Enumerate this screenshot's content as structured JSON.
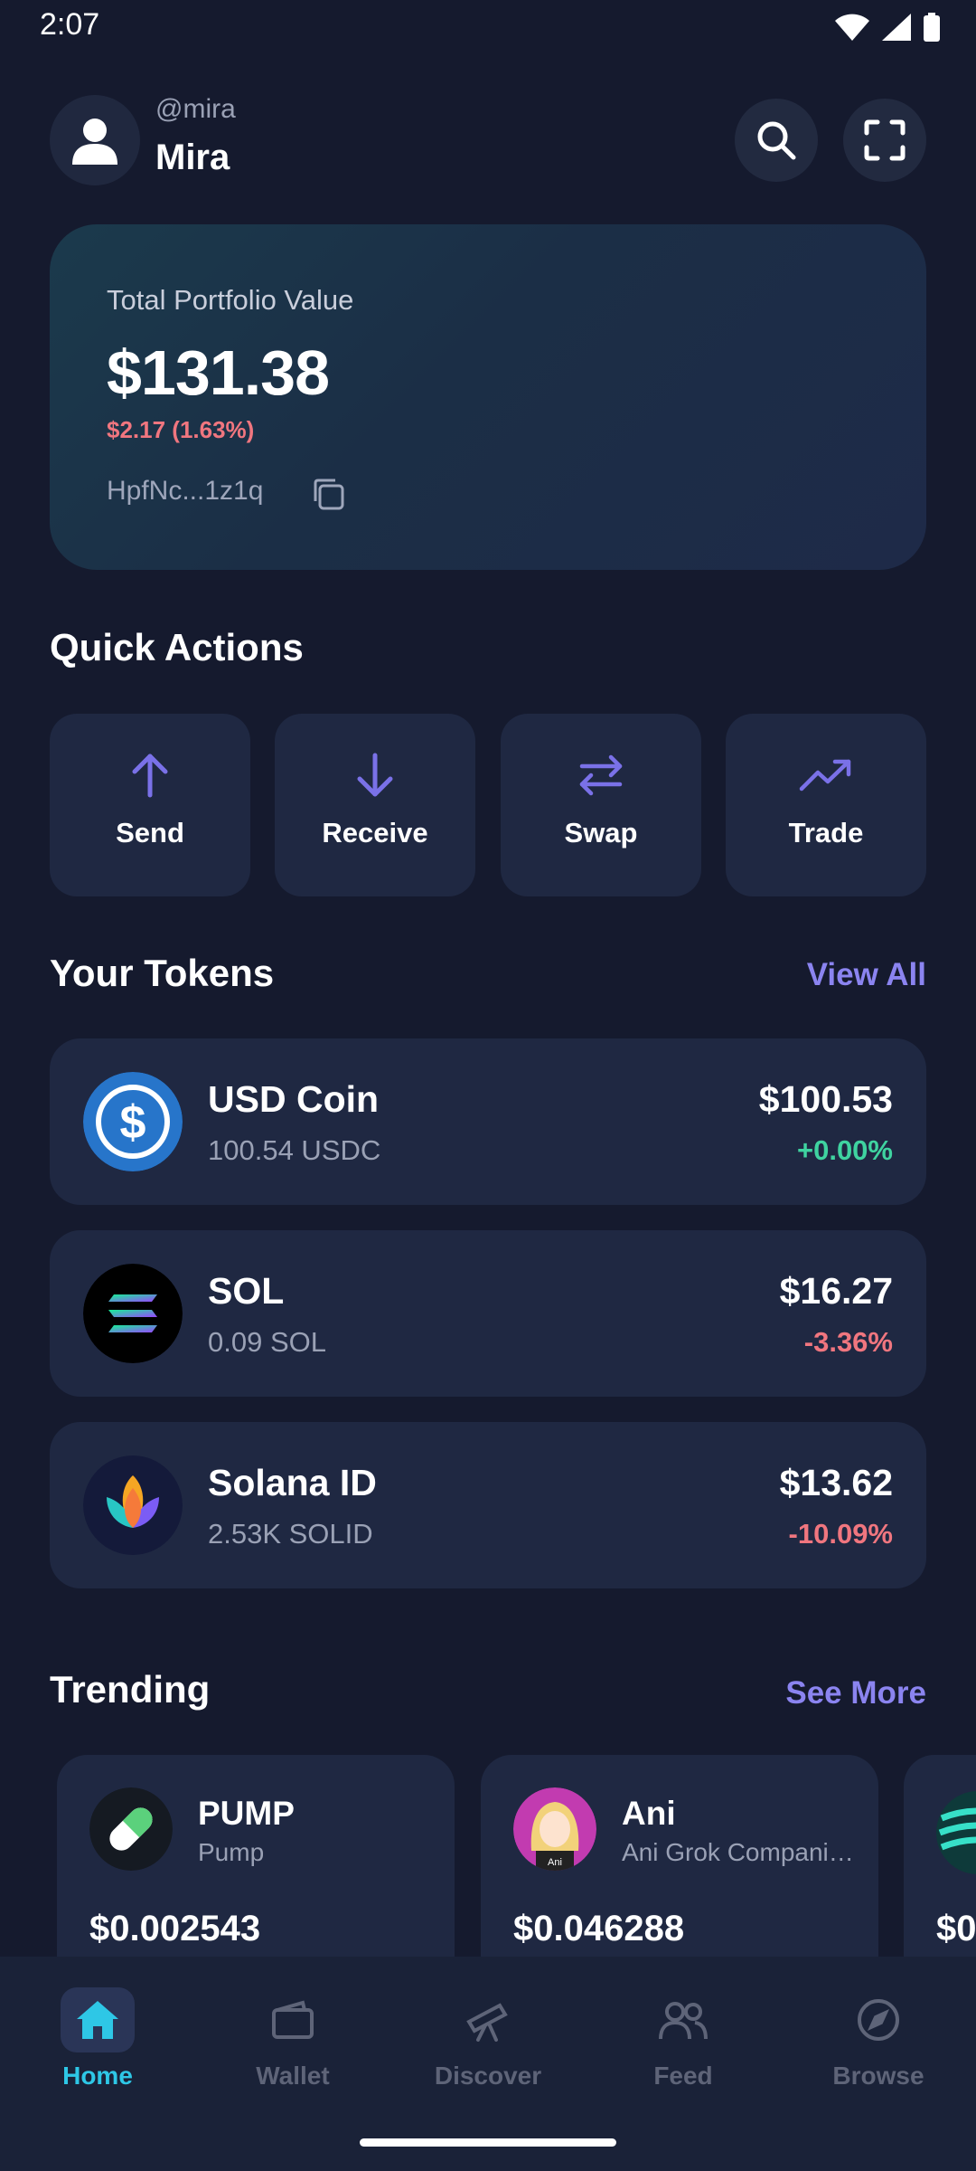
{
  "status_bar": {
    "time": "2:07",
    "icons": [
      "wifi-icon",
      "signal-icon",
      "battery-icon"
    ]
  },
  "header": {
    "handle": "@mira",
    "name": "Mira",
    "avatar_icon": "user-icon",
    "search_icon": "search-icon",
    "scan_icon": "scan-icon"
  },
  "portfolio": {
    "label": "Total Portfolio Value",
    "value": "$131.38",
    "change": "$2.17 (1.63%)",
    "address": "HpfNc...1z1q",
    "copy_icon": "copy-icon"
  },
  "quick_actions": {
    "title": "Quick Actions",
    "items": [
      {
        "label": "Send",
        "icon": "arrow-up-icon"
      },
      {
        "label": "Receive",
        "icon": "arrow-down-icon"
      },
      {
        "label": "Swap",
        "icon": "swap-icon"
      },
      {
        "label": "Trade",
        "icon": "trending-up-icon"
      }
    ]
  },
  "tokens": {
    "title": "Your Tokens",
    "view_all": "View All",
    "items": [
      {
        "name": "USD Coin",
        "amount": "100.54 USDC",
        "value": "$100.53",
        "change": "+0.00%",
        "trend": "up"
      },
      {
        "name": "SOL",
        "amount": "0.09 SOL",
        "value": "$16.27",
        "change": "-3.36%",
        "trend": "down"
      },
      {
        "name": "Solana ID",
        "amount": "2.53K SOLID",
        "value": "$13.62",
        "change": "-10.09%",
        "trend": "down"
      }
    ]
  },
  "trending": {
    "title": "Trending",
    "see_more": "See More",
    "items": [
      {
        "symbol": "PUMP",
        "name": "Pump",
        "price": "$0.002543"
      },
      {
        "symbol": "Ani",
        "name": "Ani Grok Compani…",
        "price": "$0.046288",
        "logo_caption": "Ani"
      },
      {
        "symbol": "",
        "name": "",
        "price": "$0"
      }
    ]
  },
  "bottom_nav": {
    "items": [
      {
        "label": "Home",
        "icon": "home-icon",
        "active": true
      },
      {
        "label": "Wallet",
        "icon": "wallet-icon",
        "active": false
      },
      {
        "label": "Discover",
        "icon": "telescope-icon",
        "active": false
      },
      {
        "label": "Feed",
        "icon": "people-icon",
        "active": false
      },
      {
        "label": "Browse",
        "icon": "compass-icon",
        "active": false
      }
    ]
  },
  "colors": {
    "background": "#151a2e",
    "card": "#1f2842",
    "accent": "#8b84f0",
    "positive": "#3fd3a0",
    "negative": "#f0767f",
    "nav_active": "#2ec7e6"
  }
}
